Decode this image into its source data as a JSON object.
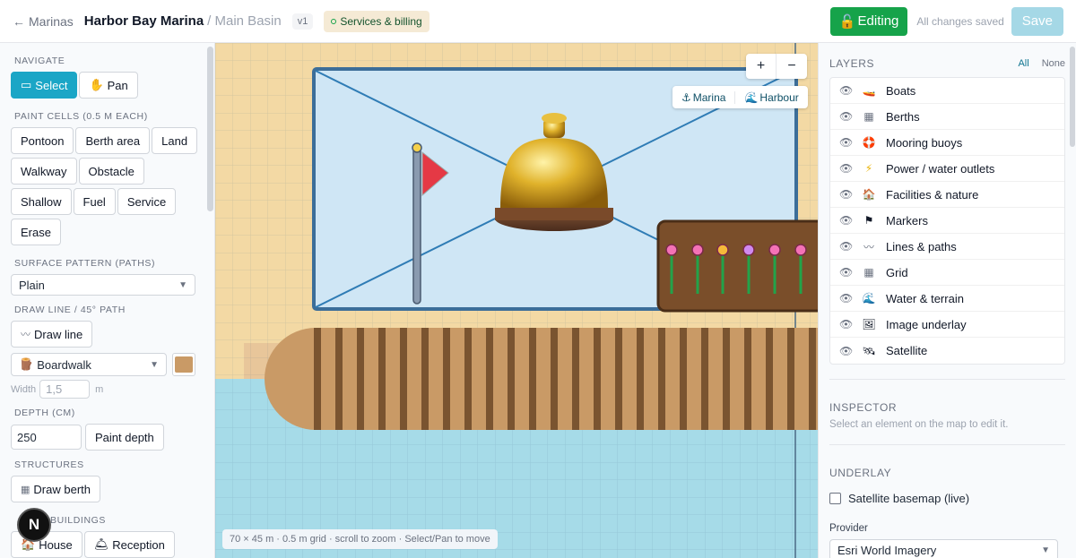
{
  "topbar": {
    "back_label": "Marinas",
    "title": "Harbor Bay Marina",
    "subtitle": "/ Main Basin",
    "version": "v1",
    "services_label": "Services & billing",
    "editing_label": "Editing",
    "saved_status": "All changes saved",
    "save_label": "Save"
  },
  "left": {
    "navigate_heading": "NAVIGATE",
    "select_label": "Select",
    "pan_label": "Pan",
    "paint_heading": "PAINT CELLS (0.5 M EACH)",
    "paint_cells": [
      "Pontoon",
      "Berth area",
      "Land",
      "Walkway",
      "Obstacle",
      "Shallow",
      "Fuel",
      "Service",
      "Erase"
    ],
    "surface_heading": "SURFACE PATTERN (PATHS)",
    "surface_value": "Plain",
    "drawline_heading": "DRAW LINE / 45° PATH",
    "drawline_label": "Draw line",
    "line_type_value": "Boardwalk",
    "width_label": "Width",
    "width_value": "1,5",
    "width_unit": "m",
    "depth_heading": "DEPTH (CM)",
    "depth_value": "250",
    "paint_depth_label": "Paint depth",
    "structures_heading": "STRUCTURES",
    "draw_berth_label": "Draw berth",
    "buildings_heading": "BUILDINGS",
    "buildings": [
      "House",
      "Reception"
    ],
    "avatar_letter": "N"
  },
  "map": {
    "zoom_in": "+",
    "zoom_out": "−",
    "view_marina": "Marina",
    "view_harbour": "Harbour",
    "caption": "70 × 45 m · 0.5 m grid · scroll to zoom · Select/Pan to move"
  },
  "right": {
    "layers_heading": "LAYERS",
    "all_label": "All",
    "none_label": "None",
    "layers": [
      {
        "label": "Boats",
        "icon": "boat-icon"
      },
      {
        "label": "Berths",
        "icon": "berth-icon"
      },
      {
        "label": "Mooring buoys",
        "icon": "lifebuoy-icon"
      },
      {
        "label": "Power / water outlets",
        "icon": "lightning-icon"
      },
      {
        "label": "Facilities & nature",
        "icon": "house-icon"
      },
      {
        "label": "Markers",
        "icon": "flag-icon"
      },
      {
        "label": "Lines & paths",
        "icon": "wave-line-icon"
      },
      {
        "label": "Grid",
        "icon": "grid-icon"
      },
      {
        "label": "Water & terrain",
        "icon": "water-wave-icon"
      },
      {
        "label": "Image underlay",
        "icon": "picture-icon"
      },
      {
        "label": "Satellite",
        "icon": "satellite-icon"
      }
    ],
    "inspector_heading": "INSPECTOR",
    "inspector_hint": "Select an element on the map to edit it.",
    "underlay_heading": "UNDERLAY",
    "satellite_basemap_label": "Satellite basemap (live)",
    "provider_label": "Provider",
    "provider_value": "Esri World Imagery"
  },
  "colors": {
    "accent": "#1ba6c6",
    "editing": "#16a34a",
    "water": "#a6dbe8",
    "land": "#f3d9a4",
    "boardwalk": "#c99a66"
  }
}
